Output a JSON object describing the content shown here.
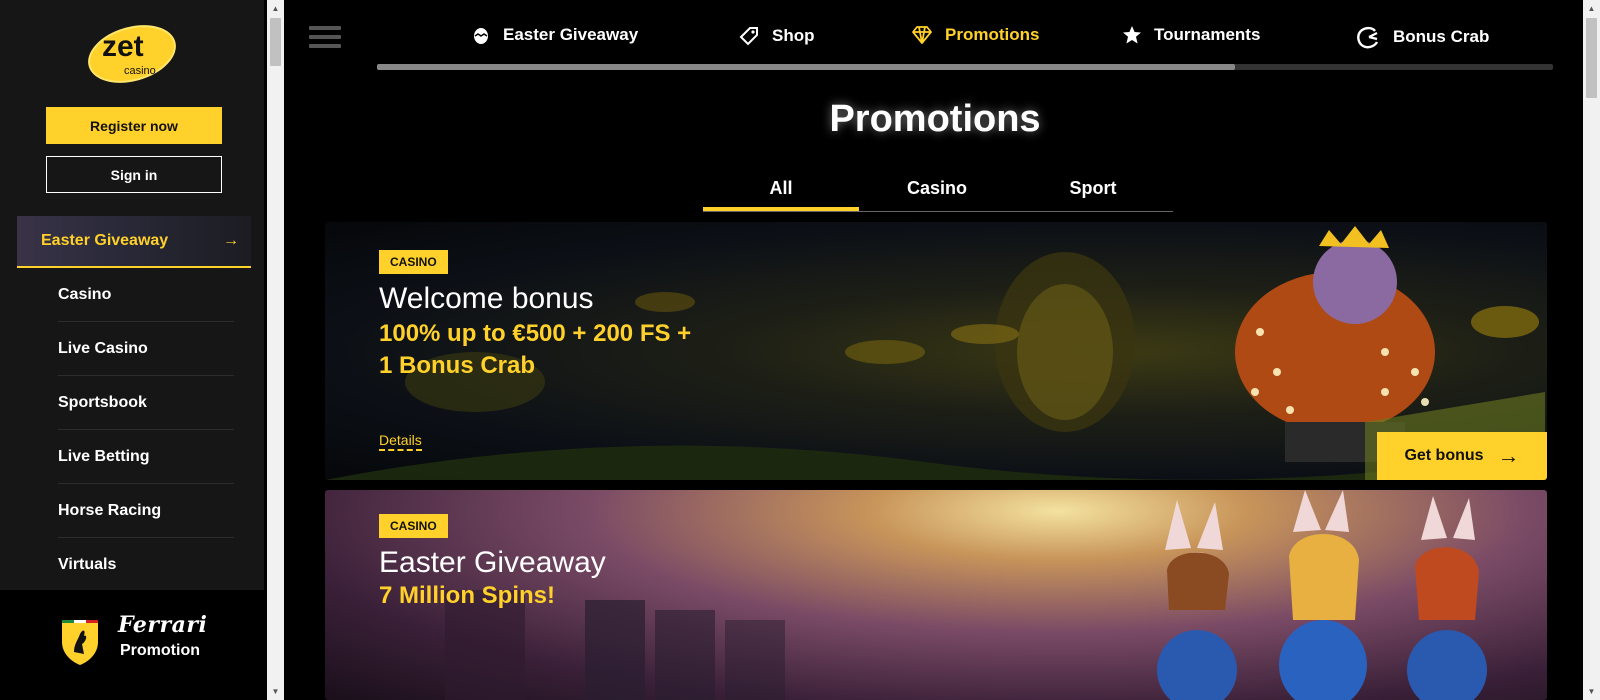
{
  "sidebar": {
    "logo_text": "zet",
    "logo_sub": "casino",
    "register_label": "Register now",
    "signin_label": "Sign in",
    "featured": {
      "label": "Easter Giveaway",
      "icon": "arrow-right-icon"
    },
    "items": [
      {
        "label": "Casino"
      },
      {
        "label": "Live Casino"
      },
      {
        "label": "Sportsbook"
      },
      {
        "label": "Live Betting"
      },
      {
        "label": "Horse Racing"
      },
      {
        "label": "Virtuals"
      }
    ],
    "ferrari": {
      "brand": "Ferrari",
      "label": "Promotion"
    }
  },
  "topnav": {
    "items": [
      {
        "label": "Easter Giveaway",
        "icon": "egg-icon"
      },
      {
        "label": "Shop",
        "icon": "shop-tag-icon"
      },
      {
        "label": "Promotions",
        "icon": "diamond-icon"
      },
      {
        "label": "Tournaments",
        "icon": "star-icon"
      },
      {
        "label": "Bonus Crab",
        "icon": "crab-claw-icon"
      }
    ],
    "active": "Promotions",
    "scroll_progress": 0.73
  },
  "page": {
    "title": "Promotions"
  },
  "tabs": [
    {
      "label": "All"
    },
    {
      "label": "Casino"
    },
    {
      "label": "Sport"
    }
  ],
  "active_tab": "All",
  "promos": [
    {
      "badge": "CASINO",
      "title": "Welcome bonus",
      "subtitle": "100% up to €500 + 200 FS + 1 Bonus Crab",
      "details_label": "Details",
      "cta_label": "Get bonus"
    },
    {
      "badge": "CASINO",
      "title": "Easter Giveaway",
      "subtitle": "7 Million Spins!"
    }
  ],
  "colors": {
    "accent": "#ffd12a",
    "background": "#000000",
    "sidebar": "#161616"
  }
}
